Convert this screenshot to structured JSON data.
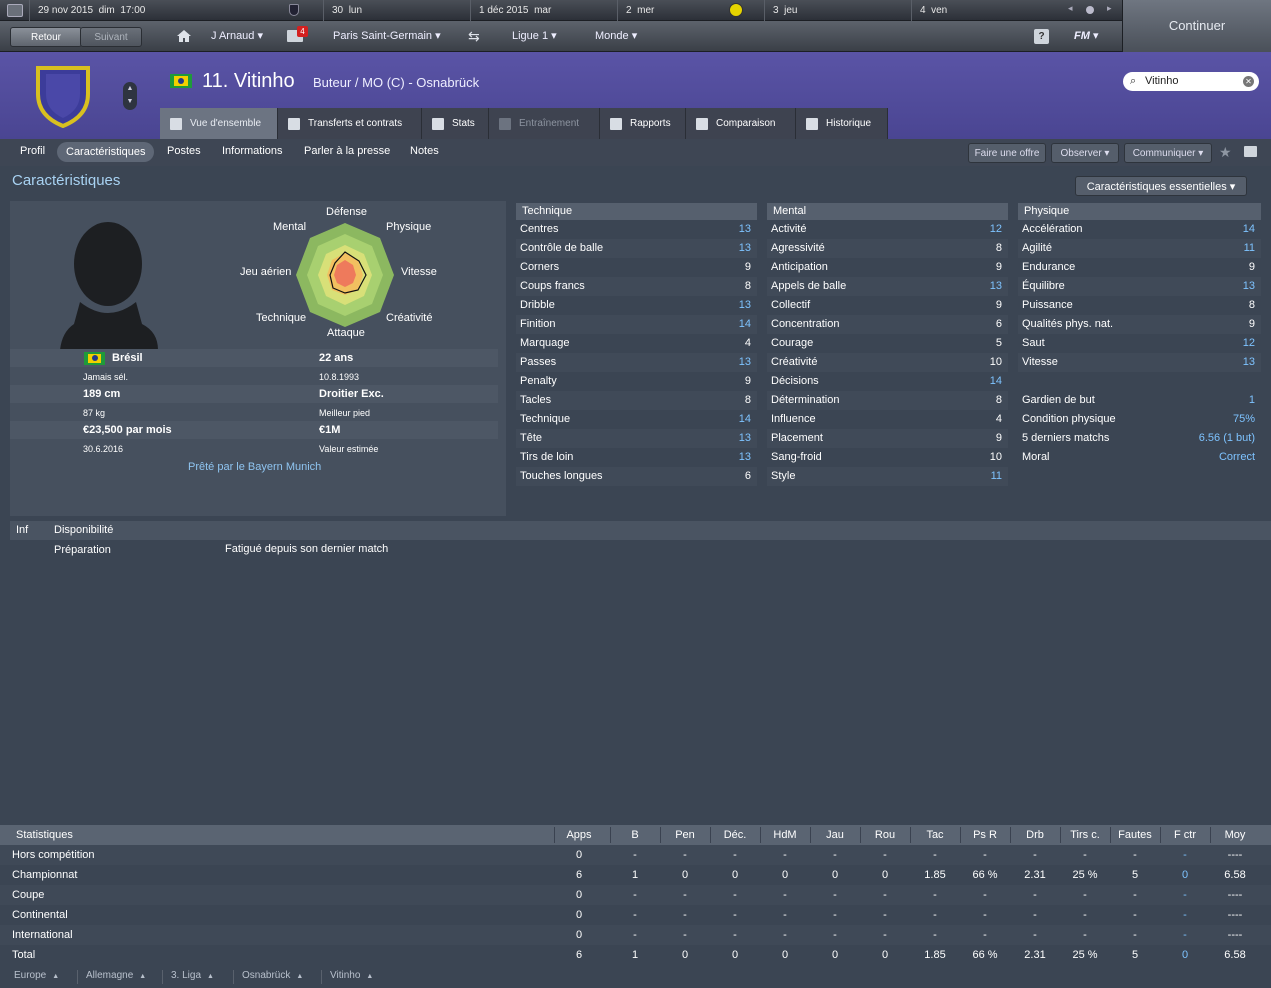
{
  "calendar": {
    "date": "29 nov 2015",
    "day": "dim",
    "time": "17:00",
    "days": [
      {
        "n": "30",
        "d": "lun"
      },
      {
        "n": "1 déc 2015",
        "d": "mar"
      },
      {
        "n": "2",
        "d": "mer"
      },
      {
        "n": "3",
        "d": "jeu"
      },
      {
        "n": "4",
        "d": "ven"
      }
    ]
  },
  "nav": {
    "back": "Retour",
    "forward": "Suivant",
    "manager": "J Arnaud",
    "badge": "4",
    "club": "Paris Saint-Germain",
    "league": "Ligue 1",
    "world": "Monde",
    "fm": "FM",
    "continue": "Continuer"
  },
  "player": {
    "number_name": "11. Vitinho",
    "role": "Buteur / MO (C) - Osnabrück",
    "search": "Vitinho"
  },
  "tabs": [
    "Vue d'ensemble",
    "Transferts et contrats",
    "Stats",
    "Entraînement",
    "Rapports",
    "Comparaison",
    "Historique"
  ],
  "subtabs": [
    "Profil",
    "Caractéristiques",
    "Postes",
    "Informations",
    "Parler à la presse",
    "Notes"
  ],
  "actions": [
    "Faire une offre",
    "Observer",
    "Communiquer"
  ],
  "section_title": "Caractéristiques",
  "view_select": "Caractéristiques essentielles",
  "radar": {
    "labels": {
      "top": "Défense",
      "tr": "Physique",
      "r": "Vitesse",
      "br": "Créativité",
      "bottom": "Attaque",
      "bl": "Technique",
      "l": "Jeu aérien",
      "tl": "Mental"
    }
  },
  "info": {
    "nation": "Brésil",
    "caps": "Jamais sél.",
    "height": "189 cm",
    "weight": "87 kg",
    "wage": "€23,500 par mois",
    "contract": "30.6.2016",
    "age": "22 ans",
    "dob": "10.8.1993",
    "foot": "Droitier Exc.",
    "foot_label": "Meilleur pied",
    "value": "€1M",
    "value_label": "Valeur estimée",
    "loan": "Prêté par le Bayern Munich"
  },
  "technique": {
    "title": "Technique",
    "rows": [
      [
        "Centres",
        "13"
      ],
      [
        "Contrôle de balle",
        "13"
      ],
      [
        "Corners",
        "9"
      ],
      [
        "Coups francs",
        "8"
      ],
      [
        "Dribble",
        "13"
      ],
      [
        "Finition",
        "14"
      ],
      [
        "Marquage",
        "4"
      ],
      [
        "Passes",
        "13"
      ],
      [
        "Penalty",
        "9"
      ],
      [
        "Tacles",
        "8"
      ],
      [
        "Technique",
        "14"
      ],
      [
        "Tête",
        "13"
      ],
      [
        "Tirs de loin",
        "13"
      ],
      [
        "Touches longues",
        "6"
      ]
    ]
  },
  "mental": {
    "title": "Mental",
    "rows": [
      [
        "Activité",
        "12"
      ],
      [
        "Agressivité",
        "8"
      ],
      [
        "Anticipation",
        "9"
      ],
      [
        "Appels de balle",
        "13"
      ],
      [
        "Collectif",
        "9"
      ],
      [
        "Concentration",
        "6"
      ],
      [
        "Courage",
        "5"
      ],
      [
        "Créativité",
        "10"
      ],
      [
        "Décisions",
        "14"
      ],
      [
        "Détermination",
        "8"
      ],
      [
        "Influence",
        "4"
      ],
      [
        "Placement",
        "9"
      ],
      [
        "Sang-froid",
        "10"
      ],
      [
        "Style",
        "11"
      ]
    ]
  },
  "physique": {
    "title": "Physique",
    "rows": [
      [
        "Accélération",
        "14"
      ],
      [
        "Agilité",
        "11"
      ],
      [
        "Endurance",
        "9"
      ],
      [
        "Équilibre",
        "13"
      ],
      [
        "Puissance",
        "8"
      ],
      [
        "Qualités phys. nat.",
        "9"
      ],
      [
        "Saut",
        "12"
      ],
      [
        "Vitesse",
        "13"
      ]
    ],
    "extra": [
      [
        "Gardien de but",
        "1"
      ],
      [
        "Condition physique",
        "75%"
      ],
      [
        "5 derniers matchs",
        "6.56 (1 but)"
      ],
      [
        "Moral",
        "Correct"
      ]
    ]
  },
  "availability": {
    "inf": "Inf",
    "title": "Disponibilité",
    "label": "Préparation",
    "value": "Fatigué depuis son dernier match"
  },
  "stats": {
    "headers": [
      "Statistiques",
      "Apps",
      "B",
      "Pen",
      "Déc.",
      "HdM",
      "Jau",
      "Rou",
      "Tac",
      "Ps R",
      "Drb",
      "Tirs c.",
      "Fautes",
      "F ctr",
      "Moy"
    ],
    "rows": [
      [
        "Hors compétition",
        "0",
        "-",
        "-",
        "-",
        "-",
        "-",
        "-",
        "-",
        "-",
        "-",
        "-",
        "-",
        "-",
        "----"
      ],
      [
        "Championnat",
        "6",
        "1",
        "0",
        "0",
        "0",
        "0",
        "0",
        "1.85",
        "66 %",
        "2.31",
        "25 %",
        "5",
        "0",
        "6.58"
      ],
      [
        "Coupe",
        "0",
        "-",
        "-",
        "-",
        "-",
        "-",
        "-",
        "-",
        "-",
        "-",
        "-",
        "-",
        "-",
        "----"
      ],
      [
        "Continental",
        "0",
        "-",
        "-",
        "-",
        "-",
        "-",
        "-",
        "-",
        "-",
        "-",
        "-",
        "-",
        "-",
        "----"
      ],
      [
        "International",
        "0",
        "-",
        "-",
        "-",
        "-",
        "-",
        "-",
        "-",
        "-",
        "-",
        "-",
        "-",
        "-",
        "----"
      ],
      [
        "Total",
        "6",
        "1",
        "0",
        "0",
        "0",
        "0",
        "0",
        "1.85",
        "66 %",
        "2.31",
        "25 %",
        "5",
        "0",
        "6.58"
      ]
    ]
  },
  "breadcrumb": [
    "Europe",
    "Allemagne",
    "3. Liga",
    "Osnabrück",
    "Vitinho"
  ]
}
